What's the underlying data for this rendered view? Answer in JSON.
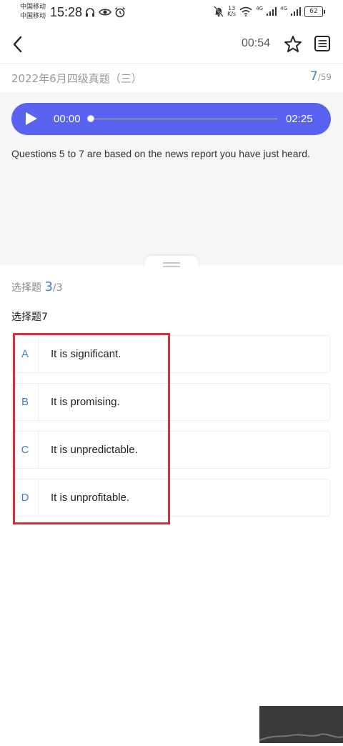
{
  "status_bar": {
    "carrier_1": "中国移动",
    "carrier_2": "中国移动",
    "time": "15:28",
    "speed_value": "13",
    "speed_unit": "K/s",
    "signal_1_label": "4G",
    "signal_2_label": "4G",
    "battery": "62"
  },
  "header": {
    "timer": "00:54"
  },
  "exam": {
    "title": "2022年6月四级真题（三）",
    "current": "7",
    "total": "/59"
  },
  "player": {
    "current_time": "00:00",
    "total_time": "02:25",
    "progress": 0
  },
  "question": {
    "prompt": "Questions 5 to 7 are based on the news report you have just heard.",
    "type_label": "选择题",
    "type_index": "3",
    "type_total": "/3",
    "name": "选择题7",
    "options": [
      {
        "letter": "A",
        "text": "It is significant."
      },
      {
        "letter": "B",
        "text": "It is promising."
      },
      {
        "letter": "C",
        "text": "It is unpredictable."
      },
      {
        "letter": "D",
        "text": "It is unprofitable."
      }
    ]
  },
  "colors": {
    "accent": "#3b82c4",
    "player": "#5a63f0",
    "highlight": "#d4323a"
  }
}
